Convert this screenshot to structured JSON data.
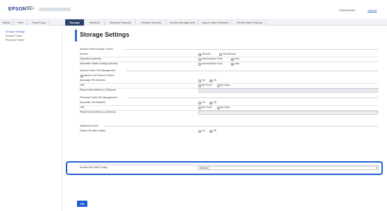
{
  "header": {
    "brand": "EPSON",
    "model": "SC-",
    "admin_label": "Administrator",
    "logout_label": "Log out"
  },
  "tabs": [
    {
      "label": "Status"
    },
    {
      "label": "Print"
    },
    {
      "label": "Scan/Copy"
    },
    {
      "label": "Storage",
      "active": true
    },
    {
      "label": "Network"
    },
    {
      "label": "Network Security"
    },
    {
      "label": "Product Security"
    },
    {
      "label": "Device Management"
    },
    {
      "label": "Epson Open Platform"
    },
    {
      "label": "Printer Data Sharing"
    }
  ],
  "sidebar": {
    "items": [
      {
        "label": "Storage Settings",
        "active": true
      },
      {
        "label": "Shared Folder"
      },
      {
        "label": "Personal Folder"
      }
    ]
  },
  "page": {
    "title": "Storage Settings"
  },
  "sections": {
    "shared_access": {
      "heading": "Shared Folder Access Control",
      "access_label": "Access",
      "access_opt1": "Allowed",
      "access_opt2": "Not Allowed",
      "operation_label": "Operation Authority",
      "operation_opt1": "Administrator Only",
      "operation_opt2": "User",
      "auto_delete_auth_label": "Automatic Delete Setting Authority",
      "auto_delete_auth_opt1": "Administrator Only",
      "auto_delete_auth_opt2": "User"
    },
    "shared_file_mgmt": {
      "heading": "Shared Folder File Management",
      "apply_all_label": "Apply to All Shared Folders",
      "auto_delete_label": "Automatic File Deletion",
      "auto_delete_opt1": "On",
      "auto_delete_opt2": "Off",
      "unit_label": "Unit",
      "unit_opt1": "By Hours",
      "unit_opt2": "By Days",
      "period_label": "Period Until Deletion (1-23hours)"
    },
    "personal_file_mgmt": {
      "heading": "Personal Folder File Management",
      "auto_delete_label": "Automatic File Deletion",
      "auto_delete_opt1": "On",
      "auto_delete_opt2": "Off",
      "unit_label": "Unit",
      "unit_opt1": "By Hours",
      "unit_opt2": "By Days",
      "period_label": "Period Until Deletion (1-23hours)"
    },
    "additional": {
      "heading": "Additional Action",
      "delete_after_output_label": "Delete File after Output",
      "delete_opt1": "On",
      "delete_opt2": "Off"
    },
    "web_config": {
      "access_label": "Access from Web Config",
      "access_value": "Allowed"
    }
  },
  "footer": {
    "ok_label": "OK"
  },
  "colors": {
    "accent": "#2d6bc6",
    "highlight": "#1f5bd3",
    "tab_active": "#2b3f6a"
  }
}
